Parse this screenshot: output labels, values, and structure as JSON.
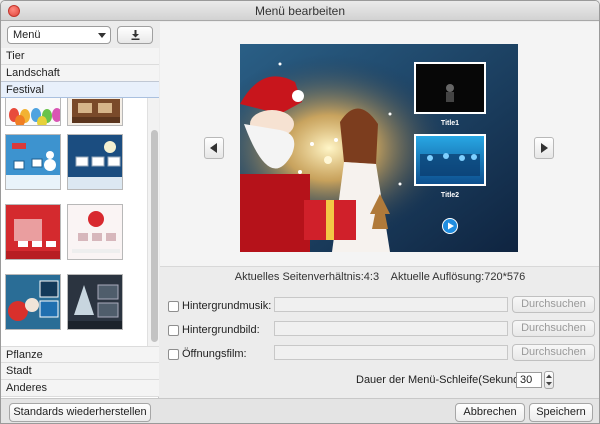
{
  "window": {
    "title": "Menü bearbeiten"
  },
  "left": {
    "select_value": "Menü",
    "categories_top": [
      "Tier",
      "Landschaft",
      "Festival"
    ],
    "categories_bottom": [
      "Pflanze",
      "Stadt",
      "Anderes"
    ],
    "selected_category": "Festival"
  },
  "preview": {
    "titles": [
      "Title1",
      "Title2"
    ],
    "info": "Aktuelles Seitenverhältnis:4:3    Aktuelle Auflösung:720*576"
  },
  "options": {
    "music_label": "Hintergrundmusik:",
    "image_label": "Hintergrundbild:",
    "film_label": "Öffnungsfilm:",
    "browse_label": "Durchsuchen",
    "loop_label": "Dauer der Menü-Schleife(Sekunde):",
    "loop_value": "30"
  },
  "buttons": {
    "restore": "Standards wiederherstellen",
    "cancel": "Abbrechen",
    "save": "Speichern"
  },
  "colors": {
    "accent": "#e8f0fb",
    "close": "#e0443a"
  },
  "icons": [
    "close-icon",
    "chevron-down-icon",
    "download-icon",
    "chevron-left-icon",
    "chevron-right-icon",
    "play-icon",
    "stepper-icon"
  ]
}
